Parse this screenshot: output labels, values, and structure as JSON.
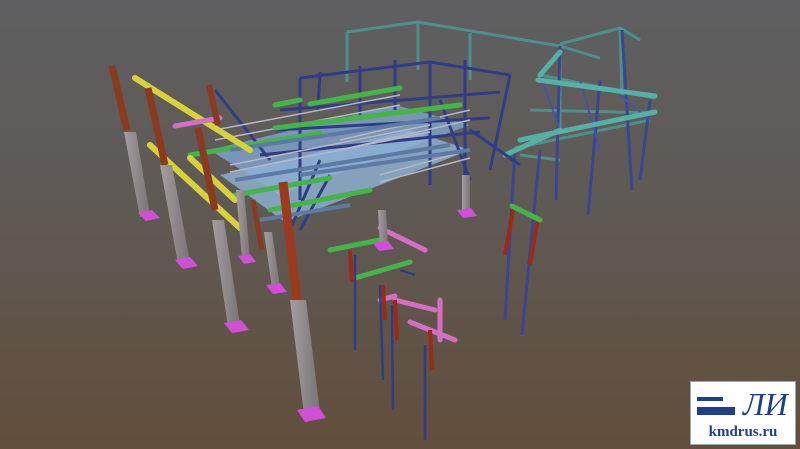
{
  "scene": {
    "subject": "3d-steel-frame-model",
    "colors": {
      "background_top": "#5e5e5f",
      "background_bottom": "#614f3e",
      "column_brown": "#8a3a1f",
      "column_red": "#9c2a14",
      "pier_concrete": "#8f888a",
      "base_plate": "#d14fd6",
      "beam_yellow": "#d8d23a",
      "beam_green": "#46b548",
      "beam_teal": "#4fa59a",
      "brace_navy": "#2e3d86",
      "beam_pink": "#d46fc4",
      "beam_steel": "#5c7aa4",
      "floor_plate": "#8fb3d6",
      "rail_grey": "#b6b6c4"
    }
  },
  "logo": {
    "mark": "ЛИ",
    "text": "kmdrus.ru",
    "color": "#1f3f8a"
  }
}
